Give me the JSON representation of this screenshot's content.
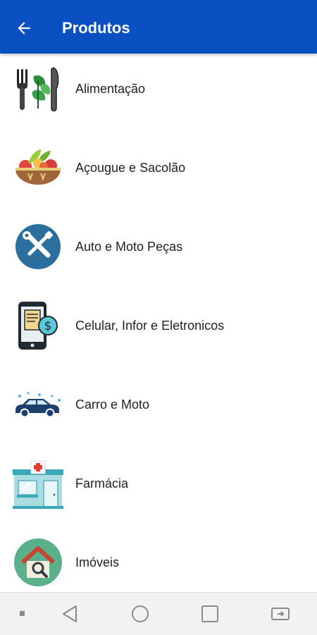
{
  "header": {
    "title": "Produtos",
    "back_icon": "arrow-left-icon"
  },
  "colors": {
    "appbar": "#0a50c2"
  },
  "categories": [
    {
      "label": "Alimentação",
      "icon": "fork-knife-leaf-icon"
    },
    {
      "label": "Açougue e Sacolão",
      "icon": "salad-bowl-icon"
    },
    {
      "label": "Auto e Moto Peças",
      "icon": "wrench-screwdriver-icon"
    },
    {
      "label": "Celular, Infor e Eletronicos",
      "icon": "phone-dollar-icon"
    },
    {
      "label": "Carro e Moto",
      "icon": "car-icon"
    },
    {
      "label": "Farmácia",
      "icon": "pharmacy-building-icon"
    },
    {
      "label": "Imóveis",
      "icon": "house-search-icon"
    }
  ],
  "navbar": {
    "icons": [
      "dot-icon",
      "back-triangle-icon",
      "home-circle-icon",
      "recents-square-icon",
      "rotate-screen-icon"
    ]
  }
}
